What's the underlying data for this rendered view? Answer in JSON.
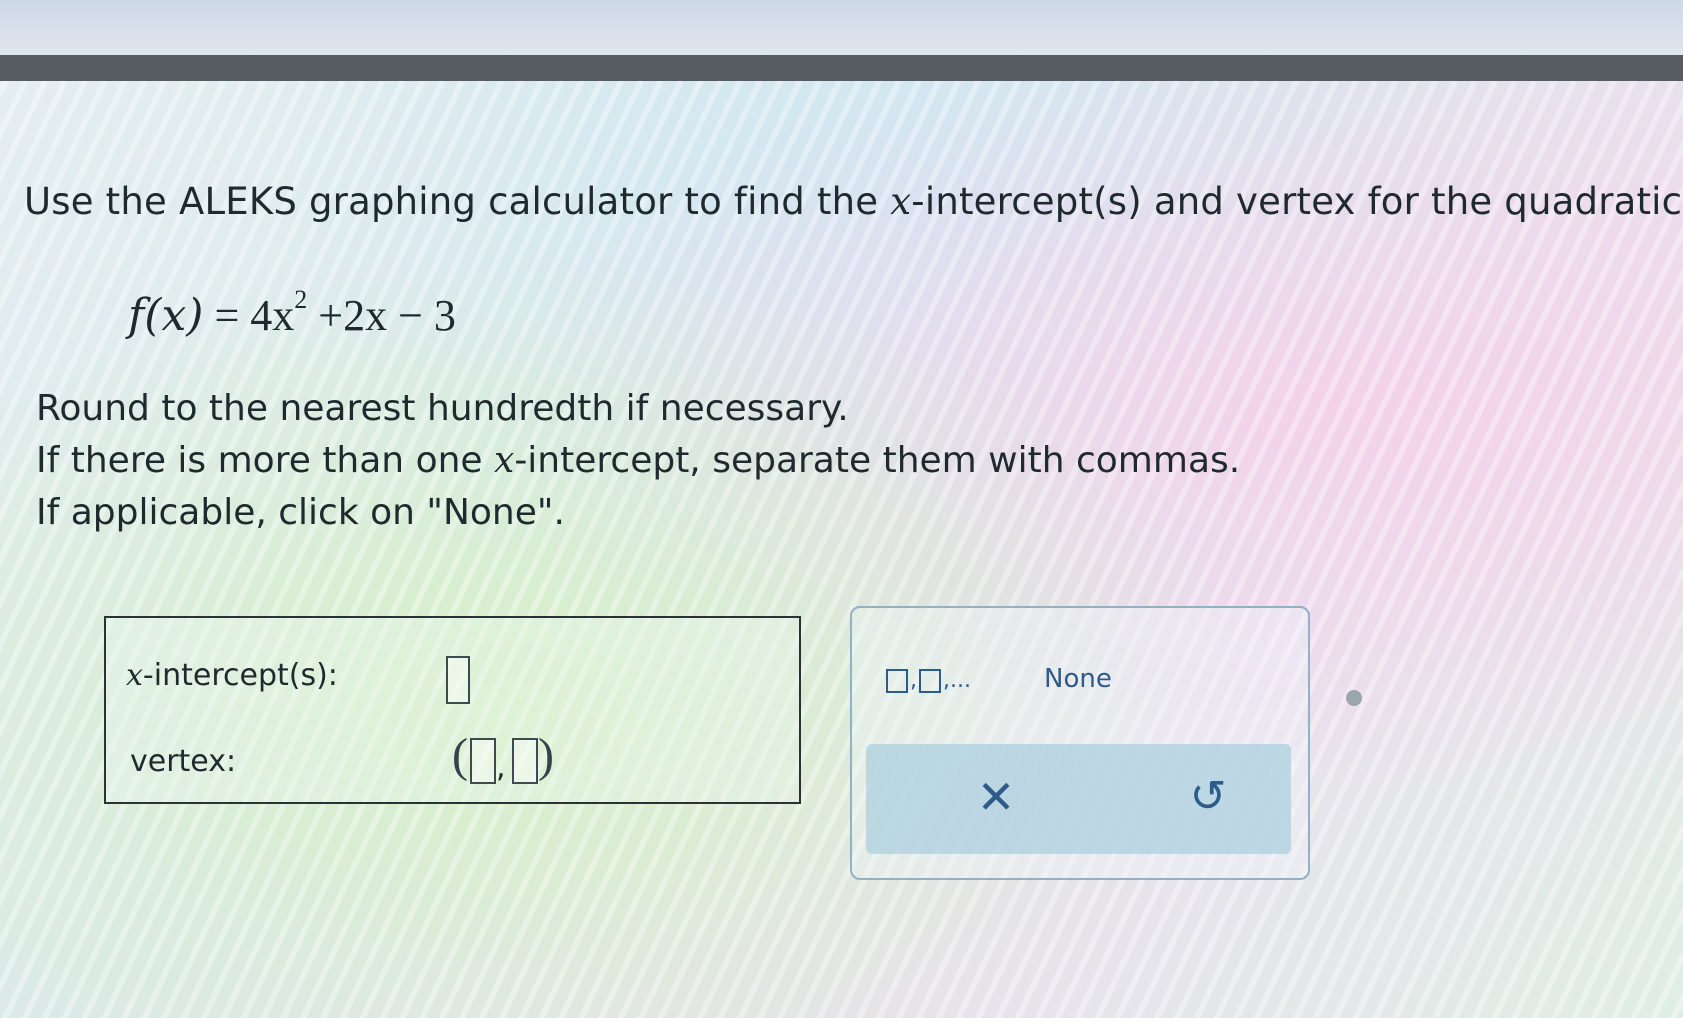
{
  "question": {
    "prefix": "Use the ALEKS graphing calculator to find the ",
    "var": "x",
    "suffix": "-intercept(s) and vertex for the quadratic fu"
  },
  "equation": {
    "lhs": "f(x)",
    "eq": " = 4x",
    "exp": "2",
    "rest": " +2x − 3"
  },
  "instructions": {
    "line1": "Round to the nearest hundredth if necessary.",
    "line2_prefix": "If there is more than one ",
    "line2_var": "x",
    "line2_suffix": "-intercept, separate them with commas.",
    "line3": "If applicable, click on \"None\"."
  },
  "answer": {
    "x_intercept_var": "x",
    "x_intercept_label": "-intercept(s):",
    "vertex_label": "vertex:",
    "vertex_comma": ","
  },
  "tools": {
    "pattern_suffix": ",...",
    "pattern_comma": ",",
    "none_label": "None",
    "clear_symbol": "✕",
    "undo_symbol": "↺"
  }
}
